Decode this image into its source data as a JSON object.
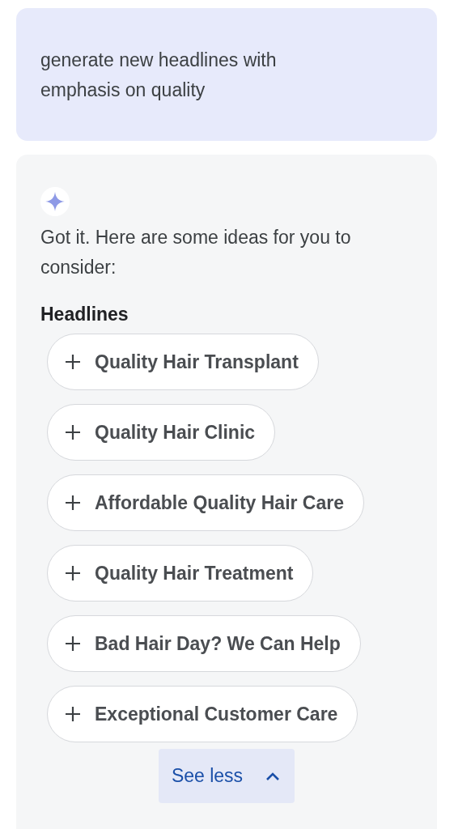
{
  "prompt": {
    "text": "generate new headlines with emphasis on quality"
  },
  "response": {
    "intro": "Got it. Here are some ideas for you to consider:",
    "section_title": "Headlines",
    "headlines": [
      {
        "text": "Quality Hair Transplant"
      },
      {
        "text": "Quality Hair Clinic"
      },
      {
        "text": "Affordable Quality Hair Care"
      },
      {
        "text": "Quality Hair Treatment"
      },
      {
        "text": "Bad Hair Day? We Can Help"
      },
      {
        "text": "Exceptional Customer Care"
      }
    ],
    "toggle": {
      "label": "See less",
      "expanded": true
    }
  }
}
